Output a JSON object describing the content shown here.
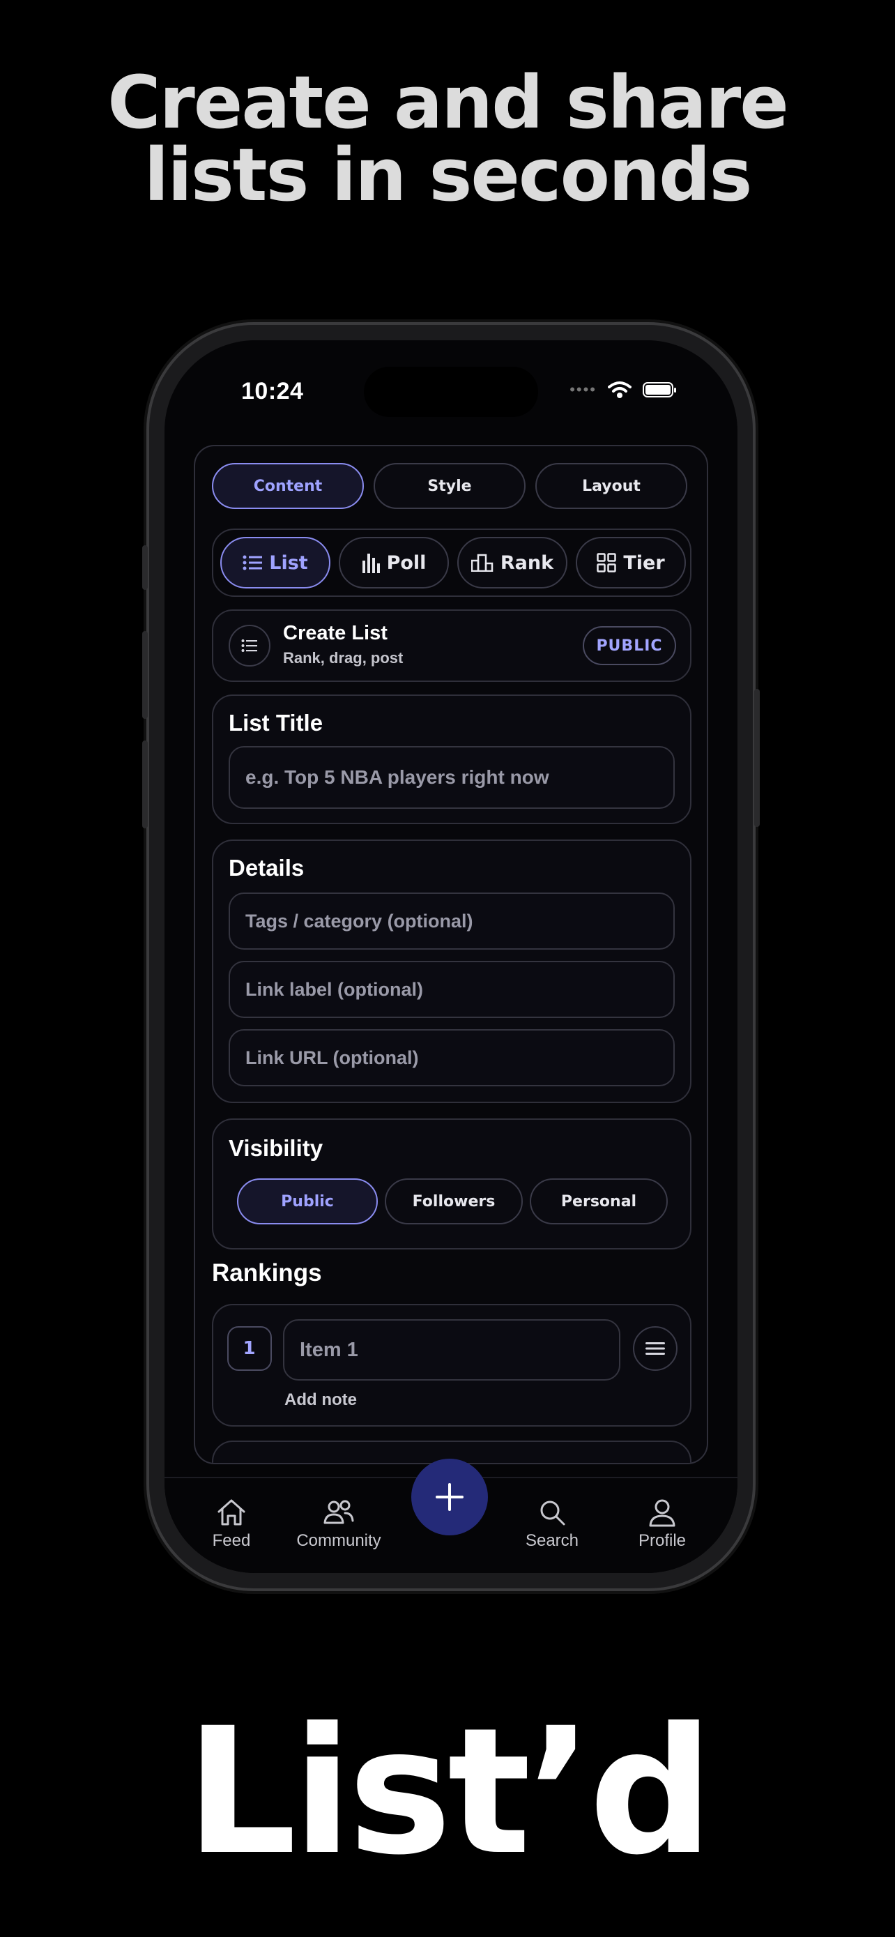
{
  "headline": [
    "Create and share",
    "lists in seconds"
  ],
  "brand": "List’d",
  "status_bar": {
    "time": "10:24"
  },
  "editor_tabs": [
    {
      "label": "Content",
      "active": true
    },
    {
      "label": "Style",
      "active": false
    },
    {
      "label": "Layout",
      "active": false
    }
  ],
  "list_types": [
    {
      "label": "List",
      "icon": "list-icon",
      "active": true
    },
    {
      "label": "Poll",
      "icon": "bar-chart-icon",
      "active": false
    },
    {
      "label": "Rank",
      "icon": "podium-icon",
      "active": false
    },
    {
      "label": "Tier",
      "icon": "grid-icon",
      "active": false
    }
  ],
  "create_card": {
    "title": "Create List",
    "subtitle": "Rank, drag, post",
    "badge": "PUBLIC"
  },
  "list_title": {
    "label": "List Title",
    "placeholder": "e.g. Top 5 NBA players right now"
  },
  "details": {
    "label": "Details",
    "fields": [
      "Tags / category (optional)",
      "Link label (optional)",
      "Link URL (optional)"
    ]
  },
  "visibility": {
    "label": "Visibility",
    "options": [
      {
        "label": "Public",
        "active": true
      },
      {
        "label": "Followers",
        "active": false
      },
      {
        "label": "Personal",
        "active": false
      }
    ]
  },
  "rankings": {
    "label": "Rankings",
    "items": [
      {
        "number": "1",
        "placeholder": "Item 1",
        "note": "Add note"
      }
    ]
  },
  "nav": [
    {
      "label": "Feed",
      "icon": "home-icon"
    },
    {
      "label": "Community",
      "icon": "people-icon"
    },
    {
      "label": "Search",
      "icon": "search-icon"
    },
    {
      "label": "Profile",
      "icon": "person-icon"
    }
  ],
  "colors": {
    "accent": "#9fa2ff",
    "fab": "#242a78",
    "background": "#000000"
  }
}
